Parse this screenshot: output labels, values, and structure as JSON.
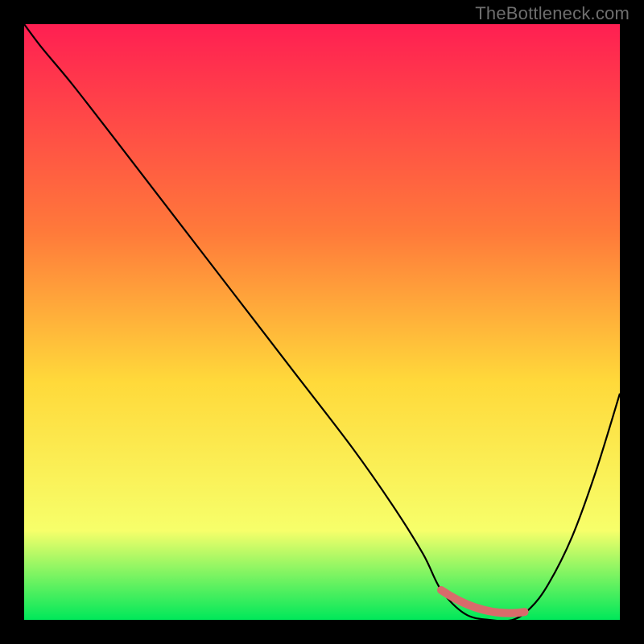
{
  "watermark": "TheBottleneck.com",
  "colors": {
    "frame": "#000000",
    "watermark": "#6e6e6e",
    "curve": "#000000",
    "band": "#d86b6b",
    "grad_top": "#ff1f52",
    "grad_mid_upper": "#ff7a3a",
    "grad_mid": "#ffd93a",
    "grad_mid_lower": "#f7ff6a",
    "grad_bottom": "#00e85a"
  },
  "chart_data": {
    "type": "line",
    "title": "",
    "xlabel": "",
    "ylabel": "",
    "xlim": [
      0,
      100
    ],
    "ylim": [
      0,
      100
    ],
    "x": [
      0,
      3,
      8,
      15,
      25,
      35,
      45,
      55,
      62,
      67,
      70,
      74,
      78,
      82,
      85,
      88,
      92,
      96,
      100
    ],
    "values": [
      100,
      96,
      90,
      81,
      68,
      55,
      42,
      29,
      19,
      11,
      5,
      1,
      0,
      0,
      2,
      6,
      14,
      25,
      38
    ],
    "optimal_band_x": [
      70,
      84
    ],
    "annotations": []
  }
}
